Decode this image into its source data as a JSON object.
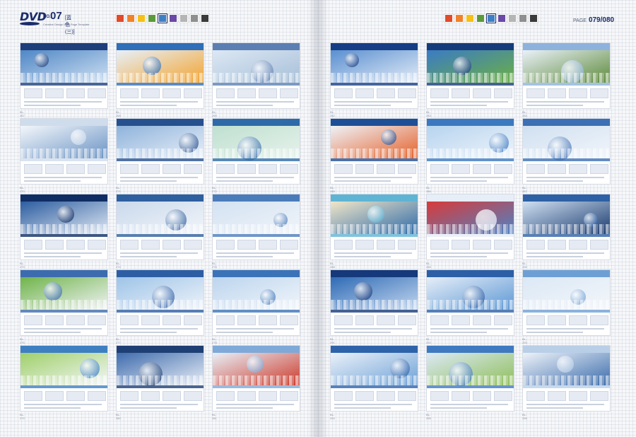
{
  "header": {
    "logo_text": "DVD",
    "issue_label": "NO.",
    "issue_number": "07",
    "issue_cn": "[蓝色(三)]",
    "subtitle": "Creative Design Web Page Template",
    "page_label": "PAGE",
    "page_value": "079/080"
  },
  "swatches": [
    "#e24b2a",
    "#f1822a",
    "#f5c116",
    "#5b9a3b",
    "#3c7fc4",
    "#6b49a6",
    "#b5b5b5",
    "#8f8f8f",
    "#3b3b3b"
  ],
  "selected_swatch": 4,
  "left_tiles": [
    {
      "caption": "BL-267",
      "colors": [
        "#1e3f7a",
        "#4f87c6",
        "#cfe0f2"
      ]
    },
    {
      "caption": "BL-268",
      "colors": [
        "#2f6eb8",
        "#e7f0fa",
        "#f2a430"
      ]
    },
    {
      "caption": "BL-269",
      "colors": [
        "#5b7fb2",
        "#dce8f4",
        "#a7bfd8"
      ]
    },
    {
      "caption": "BL-270",
      "colors": [
        "#cfdcec",
        "#f4f7fb",
        "#6a93c4"
      ]
    },
    {
      "caption": "BL-271",
      "colors": [
        "#26508e",
        "#8fb3dc",
        "#e8eff7"
      ]
    },
    {
      "caption": "BL-272",
      "colors": [
        "#2e6aa8",
        "#bfe0d0",
        "#e7f2ec"
      ]
    },
    {
      "caption": "BL-273",
      "colors": [
        "#0f2d63",
        "#2d5da0",
        "#dfe8f3"
      ]
    },
    {
      "caption": "BL-274",
      "colors": [
        "#2e5f9e",
        "#c9d9ec",
        "#f2f5f9"
      ]
    },
    {
      "caption": "BL-275",
      "colors": [
        "#4a7cba",
        "#d3e2f2",
        "#f0f4f9"
      ]
    },
    {
      "caption": "BL-276",
      "colors": [
        "#3d6cae",
        "#6fb44a",
        "#f1f3f6"
      ]
    },
    {
      "caption": "BL-277",
      "colors": [
        "#2d5ea4",
        "#9ec4e8",
        "#eef3f9"
      ]
    },
    {
      "caption": "BL-278",
      "colors": [
        "#3b73b8",
        "#bcd5ee",
        "#f1f5fa"
      ]
    },
    {
      "caption": "BL-279",
      "colors": [
        "#3e7fc2",
        "#9fd06a",
        "#f3f6f8"
      ]
    },
    {
      "caption": "BL-280",
      "colors": [
        "#1e3f73",
        "#3f6cad",
        "#e8eef6"
      ]
    },
    {
      "caption": "BL-281",
      "colors": [
        "#7fa9d8",
        "#e8f0f8",
        "#cc3a2a"
      ]
    }
  ],
  "right_tiles": [
    {
      "caption": "BL-282",
      "colors": [
        "#163e85",
        "#5a8fd0",
        "#e3ecf7"
      ]
    },
    {
      "caption": "BL-283",
      "colors": [
        "#163b7a",
        "#3a7bc4",
        "#6cb044"
      ]
    },
    {
      "caption": "BL-284",
      "colors": [
        "#8db3dc",
        "#eaf1f9",
        "#5d8a3a"
      ]
    },
    {
      "caption": "BL-285",
      "colors": [
        "#1e4f96",
        "#eef3f9",
        "#e5612a"
      ]
    },
    {
      "caption": "BL-286",
      "colors": [
        "#3b78bf",
        "#b7d4ef",
        "#eef4fa"
      ]
    },
    {
      "caption": "BL-287",
      "colors": [
        "#3c6fb3",
        "#d0e0f1",
        "#f1f5fa"
      ]
    },
    {
      "caption": "BL-288",
      "colors": [
        "#5fb4d4",
        "#f1e6c8",
        "#2d6aa8"
      ]
    },
    {
      "caption": "BL-289",
      "colors": [
        "#e7eef7",
        "#d83a3a",
        "#4d83c4"
      ]
    },
    {
      "caption": "BL-290",
      "colors": [
        "#2d60a4",
        "#cfe0f2",
        "#1a3a6e"
      ]
    },
    {
      "caption": "BL-291",
      "colors": [
        "#15397a",
        "#2f6bb6",
        "#c2d6ee"
      ]
    },
    {
      "caption": "BL-292",
      "colors": [
        "#2c5fa6",
        "#e6eef8",
        "#5d98d4"
      ]
    },
    {
      "caption": "BL-293",
      "colors": [
        "#6e9fd4",
        "#dbe8f5",
        "#f3f6fa"
      ]
    },
    {
      "caption": "BL-294",
      "colors": [
        "#2e63aa",
        "#eaf1f9",
        "#6ea1d6"
      ]
    },
    {
      "caption": "BL-295",
      "colors": [
        "#3f79c0",
        "#dce9f6",
        "#8fbf5a"
      ]
    },
    {
      "caption": "BL-296",
      "colors": [
        "#b9cfe8",
        "#eef3f9",
        "#3a6bab"
      ]
    }
  ]
}
